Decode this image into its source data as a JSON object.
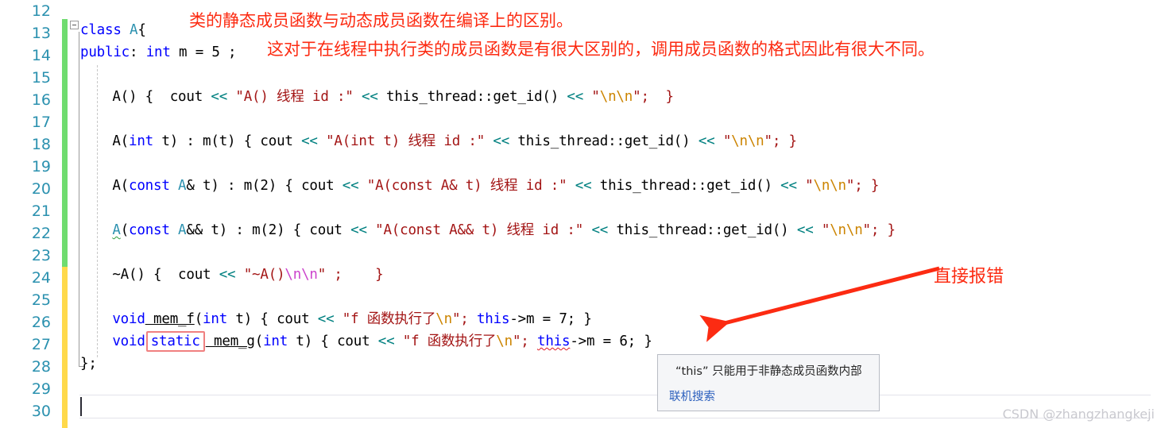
{
  "editor": {
    "line_numbers": [
      "12",
      "13",
      "14",
      "15",
      "16",
      "17",
      "18",
      "19",
      "20",
      "21",
      "22",
      "23",
      "24",
      "25",
      "26",
      "27",
      "28",
      "29",
      "30"
    ],
    "change_bars": [
      {
        "kind": "green",
        "from_line": 13,
        "to_line": 23
      },
      {
        "kind": "yellow",
        "from_line": 24,
        "to_line": 30
      }
    ],
    "colors": {
      "keyword": "#0000ff",
      "type": "#2b91af",
      "string": "#a31515",
      "stream_operator": "#008080",
      "escape_amber": "#cc8400",
      "escape_purple": "#cc44cc",
      "line_number": "#2b91af",
      "change_bar_green": "#6fdc6f",
      "change_bar_yellow": "#ffd94a",
      "annotation_red": "#fc2b12",
      "error_box": "#f08080"
    },
    "code": {
      "line13": {
        "kw_class": "class",
        "type_a": " A",
        "brace": "{"
      },
      "line14": {
        "kw_public": "public",
        "colon": ": ",
        "kw_int": "int",
        "rest": " m = 5 ;"
      },
      "line16": {
        "sig": "    A() {  cout ",
        "op1": "<<",
        "str1": " \"A() 线程 id :\" ",
        "op2": "<<",
        "mid": " this_thread::get_id() ",
        "op3": "<<",
        "q1": " \"",
        "esc1": "\\n\\n",
        "q2": "\";  }"
      },
      "line18": {
        "pre": "    A(",
        "kw_int": "int",
        "sig": " t) : m(t) { cout ",
        "op1": "<<",
        "str1": " \"A(int t) 线程 id :\" ",
        "op2": "<<",
        "mid": " this_thread::get_id() ",
        "op3": "<<",
        "q1": " \"",
        "esc1": "\\n\\n",
        "q2": "\"; }"
      },
      "line20": {
        "pre": "    A(",
        "kw_const": "const",
        "type_a": " A",
        "sig": "& t) : m(2) { cout ",
        "op1": "<<",
        "str1": " \"A(const A& t) 线程 id :\" ",
        "op2": "<<",
        "mid": " this_thread::get_id() ",
        "op3": "<<",
        "q1": " \"",
        "esc1": "\\n\\n",
        "q2": "\"; }"
      },
      "line22": {
        "indent": "    ",
        "a_squiggly": "A",
        "paren": "(",
        "kw_const": "const",
        "type_a": " A",
        "sig": "&& t) : m(2) { cout ",
        "op1": "<<",
        "str1": " \"A(const A&& t) 线程 id :\" ",
        "op2": "<<",
        "mid": " this_thread::get_id() ",
        "op3": "<<",
        "q1": " \"",
        "esc1": "\\n\\n",
        "q2": "\"; }"
      },
      "line24": {
        "sig": "    ~A() {  cout ",
        "op1": "<<",
        "q1": " \"~A()",
        "esc1": "\\n\\n",
        "q2": "\" ;    }"
      },
      "line26": {
        "indent": "    ",
        "kw_void": "void",
        "fname": " mem_f",
        "p1": "(",
        "kw_int": "int",
        "p2": " t) { cout ",
        "op1": "<<",
        "q1": " \"f 函数执行了",
        "esc1": "\\n",
        "q2": "\"; ",
        "kw_this": "this",
        "tail": "->m = 7; }"
      },
      "line27": {
        "indent": "    ",
        "kw_void": "void",
        "kw_static": "static",
        "fname": " mem_g",
        "p1": "(",
        "kw_int": "int",
        "p2": " t) { cout ",
        "op1": "<<",
        "q1": " \"f 函数执行了",
        "esc1": "\\n",
        "q2": "\"; ",
        "kw_this": "this",
        "tail": "->m = 6; }"
      },
      "line28": {
        "text": "};"
      }
    }
  },
  "annotations": {
    "title": "类的静态成员函数与动态成员函数在编译上的区别。",
    "subtitle": "这对于在线程中执行类的成员函数是有很大区别的，调用成员函数的格式因此有很大不同。",
    "error_callout": "直接报错"
  },
  "tooltip": {
    "message": "“this” 只能用于非静态成员函数内部",
    "link": "联机搜索"
  },
  "watermark": {
    "text": "CSDN @zhangzhangkeji"
  }
}
